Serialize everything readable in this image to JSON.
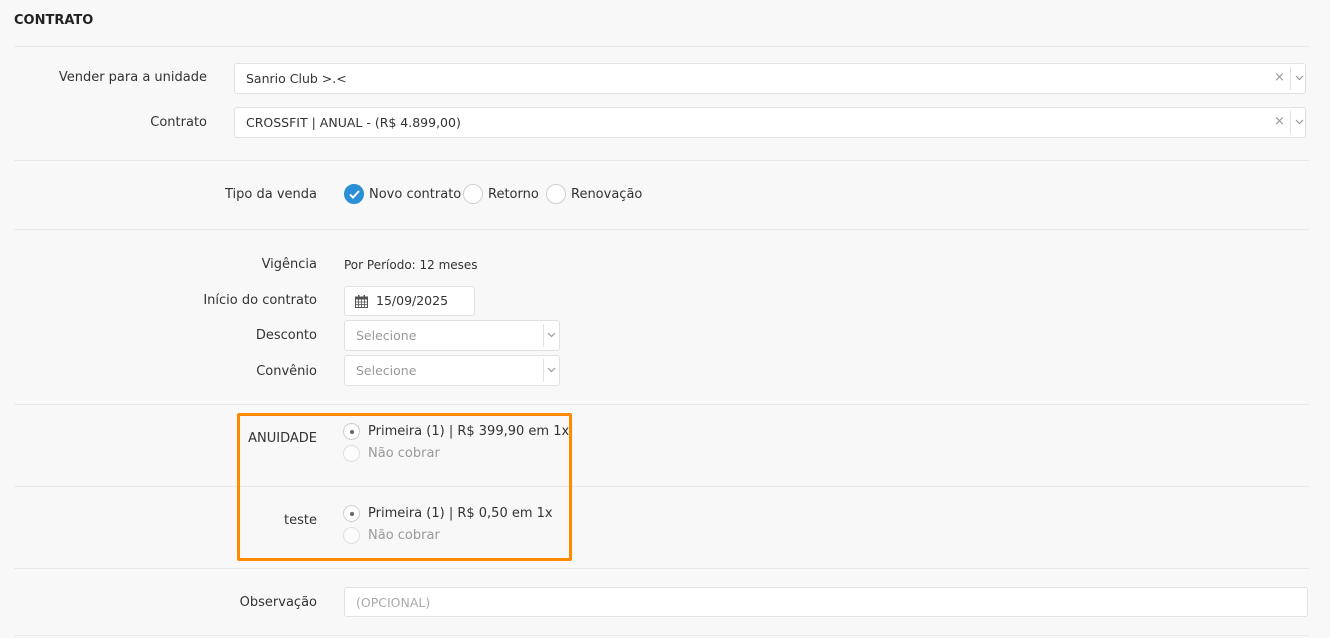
{
  "section": {
    "title": "CONTRATO"
  },
  "unidade": {
    "label": "Vender para a unidade",
    "value": "Sanrio Club >.<",
    "clear": "×"
  },
  "contrato": {
    "label": "Contrato",
    "value": "CROSSFIT | ANUAL - (R$ 4.899,00)",
    "clear": "×"
  },
  "tipo_venda": {
    "label": "Tipo da venda",
    "options": [
      {
        "label": "Novo contrato",
        "checked": true
      },
      {
        "label": "Retorno",
        "checked": false
      },
      {
        "label": "Renovação",
        "checked": false
      }
    ]
  },
  "vigencia": {
    "label": "Vigência",
    "value": "Por Período: 12 meses"
  },
  "inicio": {
    "label": "Início do contrato",
    "value": "15/09/2025"
  },
  "desconto": {
    "label": "Desconto",
    "placeholder": "Selecione"
  },
  "convenio": {
    "label": "Convênio",
    "placeholder": "Selecione"
  },
  "taxas": [
    {
      "label": "ANUIDADE",
      "option_1": "Primeira (1) | R$ 399,90 em 1x",
      "option_2": "Não cobrar"
    },
    {
      "label": "teste",
      "option_1": "Primeira (1) | R$ 0,50 em 1x",
      "option_2": "Não cobrar"
    }
  ],
  "observacao": {
    "label": "Observação",
    "placeholder": "(OPCIONAL)"
  },
  "colors": {
    "accent": "#2b8fd6",
    "highlight": "#ff8a00"
  }
}
